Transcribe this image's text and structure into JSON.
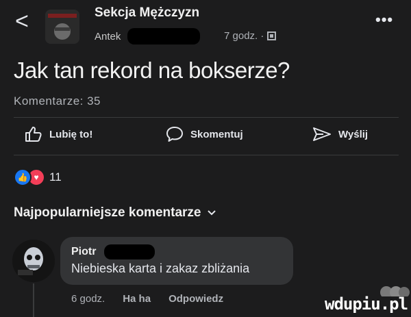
{
  "header": {
    "back_icon": "chevron-left-icon",
    "group_name": "Sekcja Mężczyzn",
    "author": "Antek",
    "time": "7 godz. ·",
    "privacy_icon": "group-privacy-icon",
    "more_icon": "more-icon"
  },
  "post": {
    "title": "Jak tan rekord na bokserze?",
    "comment_count": "Komentarze: 35"
  },
  "actions": [
    {
      "label": "Lubię to!",
      "icon": "thumbs-up-icon"
    },
    {
      "label": "Skomentuj",
      "icon": "comment-bubble-icon"
    },
    {
      "label": "Wyślij",
      "icon": "send-icon"
    }
  ],
  "reactions": {
    "count": "11",
    "types": [
      "like",
      "love"
    ],
    "colors": {
      "like": "#1877f2",
      "love": "#f33e58"
    }
  },
  "comments_section": {
    "title": "Najpopularniejsze komentarze",
    "dropdown_icon": "chevron-down-icon"
  },
  "comment": {
    "author": "Piotr",
    "text": "Niebieska karta i zakaz zbliżania",
    "time": "6 godz.",
    "reaction_label": "Ha ha",
    "reply_label": "Odpowiedz"
  },
  "watermark": "wdupiu.pl",
  "colors": {
    "background": "#1c1c1d",
    "bubble": "#333436",
    "text_primary": "#e4e6eb",
    "text_secondary": "#b0b3b8"
  }
}
